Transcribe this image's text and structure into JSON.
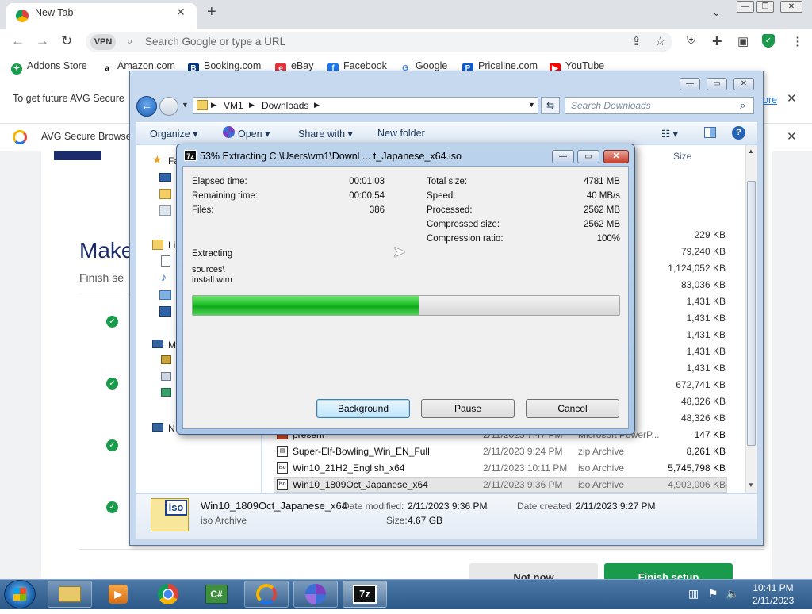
{
  "browser": {
    "tab_title": "New Tab",
    "omnibox_placeholder": "Search Google or type a URL",
    "vpn_label": "VPN",
    "bookmarks": [
      "Addons Store",
      "Amazon.com",
      "Booking.com",
      "eBay",
      "Facebook",
      "Google",
      "Priceline.com",
      "YouTube"
    ],
    "banner1_text": "To get future AVG Secure",
    "banner1_link": "ore",
    "banner2_text": "AVG Secure Browse",
    "page_heading": "Make",
    "page_sub": "Finish se",
    "btn_not_now": "Not now",
    "btn_finish": "Finish setup"
  },
  "explorer": {
    "breadcrumb": [
      "VM1",
      "Downloads"
    ],
    "search_placeholder": "Search Downloads",
    "commands": [
      "Organize",
      "Open",
      "Share with",
      "New folder"
    ],
    "size_header": "Size",
    "nav_items": [
      "Fa",
      "Li",
      "M",
      "N"
    ],
    "sizes": [
      "229 KB",
      "79,240 KB",
      "1,124,052 KB",
      "83,036 KB",
      "1,431 KB",
      "1,431 KB",
      "1,431 KB",
      "1,431 KB",
      "1,431 KB",
      "672,741 KB",
      "48,326 KB",
      "48,326 KB"
    ],
    "files": [
      {
        "name": "present",
        "date": "2/11/2023 7:47 PM",
        "type": "Microsoft PowerP...",
        "size": "147 KB"
      },
      {
        "name": "Super-Elf-Bowling_Win_EN_Full",
        "date": "2/11/2023 9:24 PM",
        "type": "zip Archive",
        "size": "8,261 KB"
      },
      {
        "name": "Win10_21H2_English_x64",
        "date": "2/11/2023 10:11 PM",
        "type": "iso Archive",
        "size": "5,745,798 KB"
      },
      {
        "name": "Win10_1809Oct_Japanese_x64",
        "date": "2/11/2023 9:36 PM",
        "type": "iso Archive",
        "size": "4,902,006 KB"
      }
    ],
    "details": {
      "icon_label": "iso",
      "name": "Win10_1809Oct_Japanese_x64",
      "type": "iso Archive",
      "modified_label": "Date modified:",
      "modified": "2/11/2023 9:36 PM",
      "created_label": "Date created:",
      "created": "2/11/2023 9:27 PM",
      "size_label": "Size:",
      "size": "4.67 GB"
    }
  },
  "sevenzip": {
    "icon_label": "7z",
    "title": "53% Extracting C:\\Users\\vm1\\Downl ... t_Japanese_x64.iso",
    "progress_fraction": 0.53,
    "left_stats": [
      {
        "label": "Elapsed time:",
        "value": "00:01:03"
      },
      {
        "label": "Remaining time:",
        "value": "00:00:54"
      },
      {
        "label": "Files:",
        "value": "386"
      }
    ],
    "right_stats": [
      {
        "label": "Total size:",
        "value": "4781 MB"
      },
      {
        "label": "Speed:",
        "value": "40 MB/s"
      },
      {
        "label": "Processed:",
        "value": "2562 MB"
      },
      {
        "label": "Compressed size:",
        "value": "2562 MB"
      },
      {
        "label": "Compression ratio:",
        "value": "100%"
      }
    ],
    "status": "Extracting",
    "path_line1": "sources\\",
    "path_line2": "install.wim",
    "btn_background": "Background",
    "btn_pause": "Pause",
    "btn_cancel": "Cancel"
  },
  "taskbar": {
    "apps": [
      "explorer-icon",
      "media-player-icon",
      "chrome-icon",
      "csharp-icon",
      "avg-browser-icon",
      "app-icon",
      "7zip-icon"
    ],
    "time": "10:41 PM",
    "date": "2/11/2023"
  },
  "colors": {
    "progress_green": "#1fbf2a",
    "avg_check": "#1a9b4b",
    "finish_btn": "#1a9b4b"
  }
}
